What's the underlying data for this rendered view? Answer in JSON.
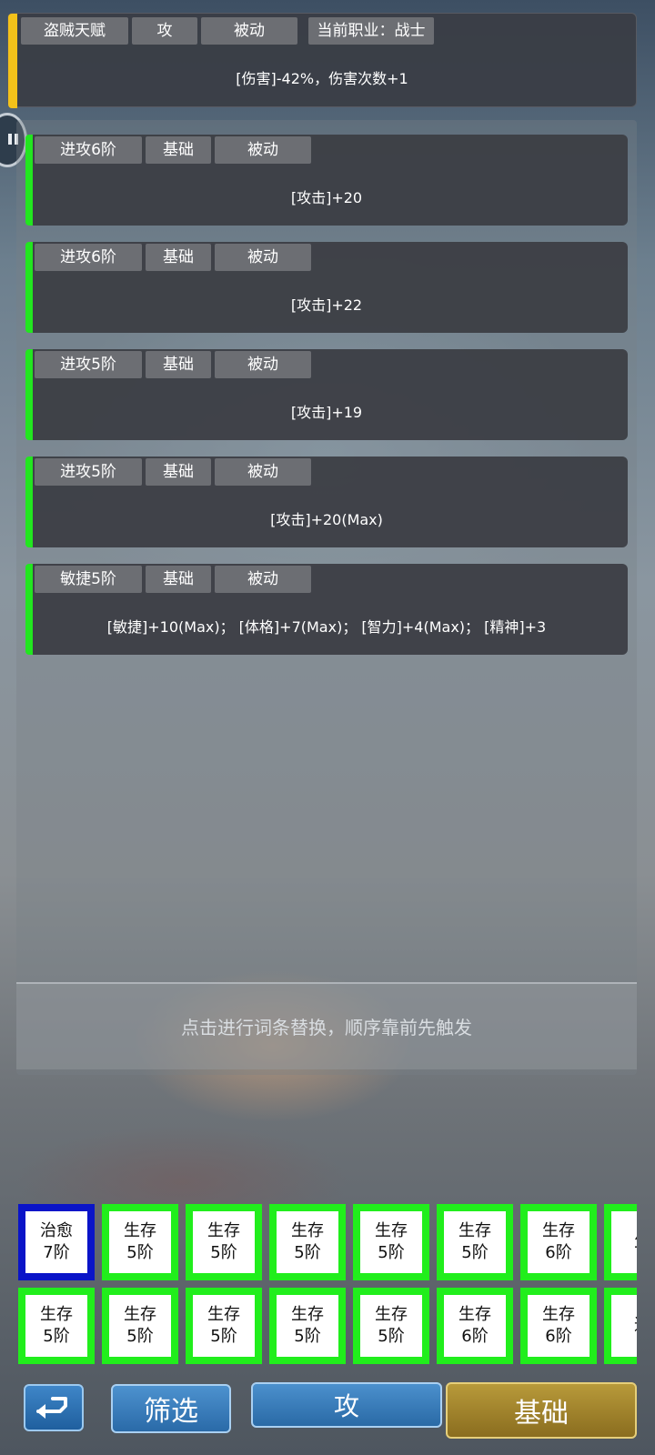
{
  "talent": {
    "tags": [
      "盗贼天赋",
      "攻",
      "被动",
      "当前职业：战士"
    ],
    "effect": "[伤害]-42%，伤害次数+1",
    "accent_color": "#f3c21a"
  },
  "affixes": [
    {
      "tags": [
        "进攻6阶",
        "基础",
        "被动"
      ],
      "effect": "[攻击]+20"
    },
    {
      "tags": [
        "进攻6阶",
        "基础",
        "被动"
      ],
      "effect": "[攻击]+22"
    },
    {
      "tags": [
        "进攻5阶",
        "基础",
        "被动"
      ],
      "effect": "[攻击]+19"
    },
    {
      "tags": [
        "进攻5阶",
        "基础",
        "被动"
      ],
      "effect": "[攻击]+20(Max)"
    },
    {
      "tags": [
        "敏捷5阶",
        "基础",
        "被动"
      ],
      "effect": "[敏捷]+10(Max)； [体格]+7(Max)； [智力]+4(Max)； [精神]+3"
    }
  ],
  "affix_accent_color": "#22e61f",
  "hint": "点击进行词条替换，顺序靠前先触发",
  "grid": {
    "row1": [
      {
        "name": "治愈",
        "tier": "7阶",
        "selected": true
      },
      {
        "name": "生存",
        "tier": "5阶"
      },
      {
        "name": "生存",
        "tier": "5阶"
      },
      {
        "name": "生存",
        "tier": "5阶"
      },
      {
        "name": "生存",
        "tier": "5阶"
      },
      {
        "name": "生存",
        "tier": "5阶"
      },
      {
        "name": "生存",
        "tier": "6阶"
      },
      {
        "name": "生",
        "tier": ""
      }
    ],
    "row2": [
      {
        "name": "生存",
        "tier": "5阶"
      },
      {
        "name": "生存",
        "tier": "5阶"
      },
      {
        "name": "生存",
        "tier": "5阶"
      },
      {
        "name": "生存",
        "tier": "5阶"
      },
      {
        "name": "生存",
        "tier": "5阶"
      },
      {
        "name": "生存",
        "tier": "6阶"
      },
      {
        "name": "生存",
        "tier": "6阶"
      },
      {
        "name": "进",
        "tier": ""
      }
    ],
    "border_color": "#21ee1c",
    "selected_border_color": "#0a14c8"
  },
  "buttons": {
    "back_icon": "return-arrow-icon",
    "filter": "筛选",
    "attack": "攻",
    "base": "基础"
  }
}
